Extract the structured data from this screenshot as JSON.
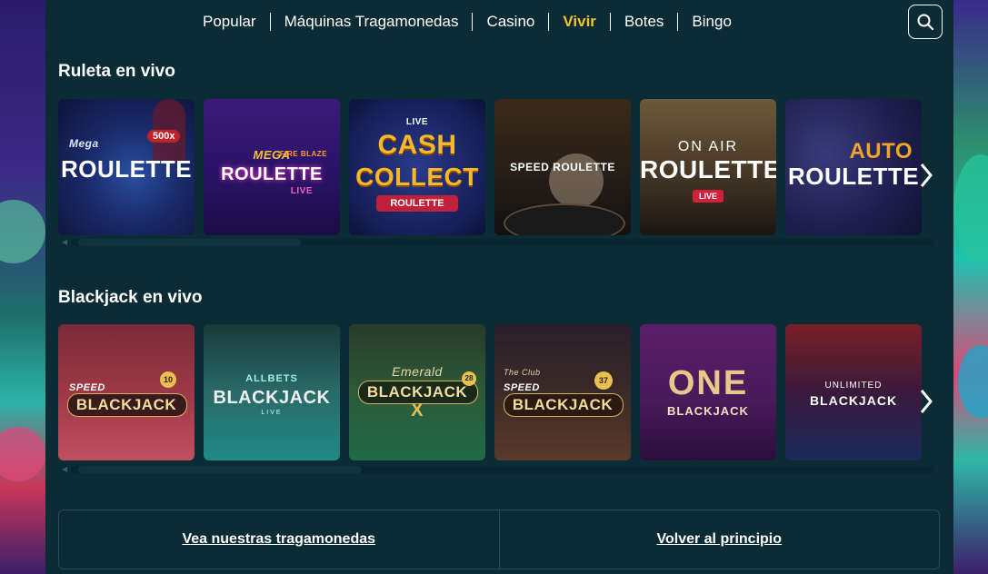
{
  "nav": {
    "items": [
      {
        "label": "Popular"
      },
      {
        "label": "Máquinas Tragamonedas"
      },
      {
        "label": "Casino"
      },
      {
        "label": "Vivir"
      },
      {
        "label": "Botes"
      },
      {
        "label": "Bingo"
      }
    ],
    "active_index": 3,
    "active_color": "#f2c230",
    "search_icon": "search-icon"
  },
  "sections": [
    {
      "title": "Ruleta en vivo",
      "games": [
        {
          "line1": "Mega",
          "line2": "ROULETTE",
          "badge": "500x"
        },
        {
          "line1": "MEGA",
          "line2": "ROULETTE",
          "sub": "LIVE",
          "tag": "FIRE BLAZE"
        },
        {
          "line1": "CASH",
          "line2": "COLLECT",
          "sub": "ROULETTE",
          "tag": "LIVE"
        },
        {
          "line1": "SPEED ROULETTE"
        },
        {
          "line1": "ON AIR",
          "line2": "ROULETTE",
          "sub": "LIVE"
        },
        {
          "line1": "AUTO",
          "line2": "ROULETTE"
        }
      ]
    },
    {
      "title": "Blackjack en vivo",
      "games": [
        {
          "line1": "SPEED",
          "line2": "BLACKJACK",
          "badge": "10"
        },
        {
          "line1": "ALLBETS",
          "line2": "BLACKJACK",
          "sub": "LIVE"
        },
        {
          "line1": "Emerald",
          "line2": "BLACKJACK",
          "sub": "X",
          "badge": "28"
        },
        {
          "line1": "SPEED",
          "line2": "BLACKJACK",
          "tag": "The Club",
          "badge": "37"
        },
        {
          "line1": "ONE",
          "line2": "BLACKJACK"
        },
        {
          "line1": "UNLIMITED",
          "line2": "BLACKJACK"
        }
      ]
    }
  ],
  "footer": {
    "left_link": "Vea nuestras tragamonedas",
    "right_link": "Volver al principio"
  }
}
